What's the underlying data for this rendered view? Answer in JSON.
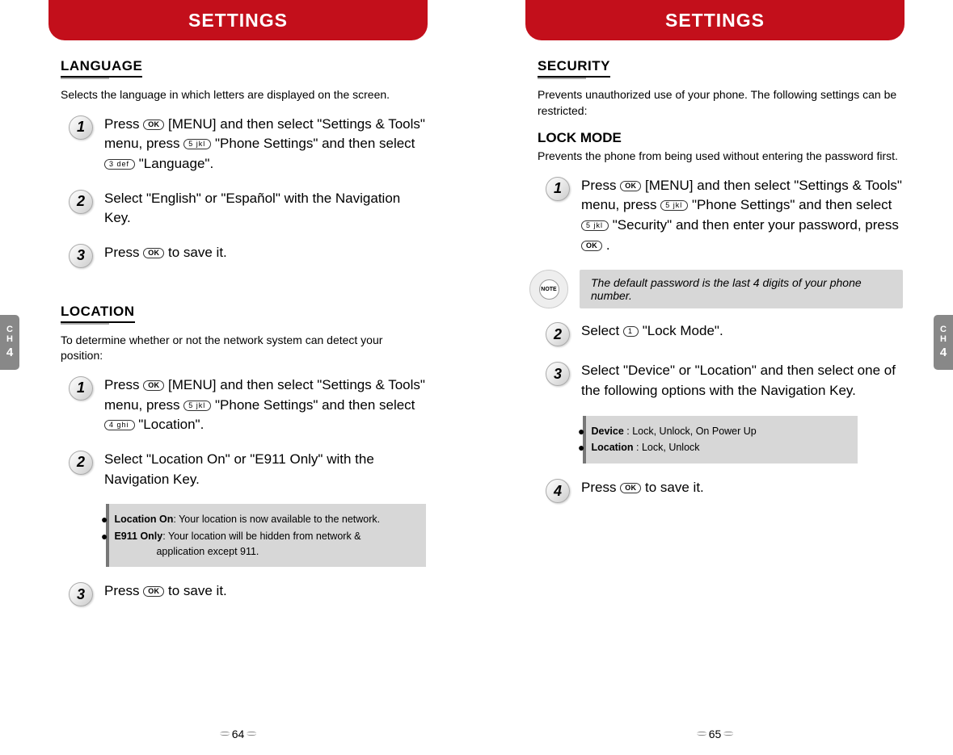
{
  "left": {
    "header": "SETTINGS",
    "side_tab_ch": "C\nH",
    "side_tab_num": "4",
    "page_num": "64",
    "language": {
      "heading": "LANGUAGE",
      "desc": "Selects the language in which letters are displayed on the screen.",
      "step1_a": "Press ",
      "step1_b": " [MENU] and then select \"Settings & Tools\" menu, press ",
      "step1_c": " \"Phone Settings\" and then select ",
      "step1_d": " \"Language\".",
      "step2": "Select \"English\" or \"Español\" with the Navigation Key.",
      "step3_a": "Press ",
      "step3_b": " to save it."
    },
    "location": {
      "heading": "LOCATION",
      "desc": "To determine whether or not the network system can detect your position:",
      "step1_a": "Press ",
      "step1_b": " [MENU] and then select \"Settings & Tools\" menu, press ",
      "step1_c": " \"Phone Settings\" and then select ",
      "step1_d": " \"Location\".",
      "step2": "Select \"Location On\" or \"E911 Only\" with the Navigation Key.",
      "info_bold1": "Location On",
      "info_text1": ": Your location is now available to the network.",
      "info_bold2": "E911 Only",
      "info_text2a": ": Your location will be hidden from network &",
      "info_text2b": "application except 911.",
      "step3_a": "Press ",
      "step3_b": " to save it."
    }
  },
  "right": {
    "header": "SETTINGS",
    "side_tab_ch": "C\nH",
    "side_tab_num": "4",
    "page_num": "65",
    "security": {
      "heading": "SECURITY",
      "desc": "Prevents unauthorized use of your phone. The following settings can be restricted:",
      "lock_mode_heading": "LOCK MODE",
      "lock_mode_desc": "Prevents the phone from being used without entering the password first.",
      "step1_a": "Press ",
      "step1_b": " [MENU] and then select \"Settings & Tools\" menu, press ",
      "step1_c": " \"Phone Settings\" and then select ",
      "step1_d": " \"Security\" and then enter your password, press ",
      "step1_e": " .",
      "note": "The default password is the last 4 digits of your phone number.",
      "step2_a": "Select ",
      "step2_b": " \"Lock Mode\".",
      "step3": "Select \"Device\" or \"Location\" and then select one of the following options with the Navigation Key.",
      "info_bold1": "Device",
      "info_text1": " : Lock, Unlock, On Power Up",
      "info_bold2": "Location",
      "info_text2": " : Lock, Unlock",
      "step4_a": "Press ",
      "step4_b": " to save it."
    }
  },
  "keys": {
    "ok_label": "OK",
    "k1": "1  ",
    "k3": "3 def",
    "k4": "4 ghi",
    "k5": "5 jkl",
    "note_label": "NOTE"
  },
  "step_nums": {
    "n1": "1",
    "n2": "2",
    "n3": "3",
    "n4": "4"
  }
}
